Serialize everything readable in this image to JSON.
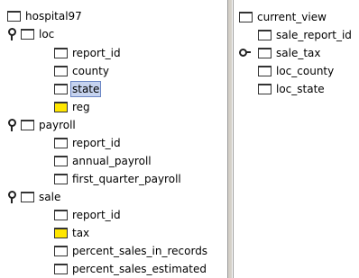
{
  "left_tree": {
    "root": {
      "label": "hospital97"
    },
    "nodes": [
      {
        "label": "loc",
        "children": [
          {
            "label": "report_id",
            "color": "white"
          },
          {
            "label": "county",
            "color": "white"
          },
          {
            "label": "state",
            "color": "white",
            "selected": true
          },
          {
            "label": "reg",
            "color": "yellow"
          }
        ]
      },
      {
        "label": "payroll",
        "children": [
          {
            "label": "report_id",
            "color": "white"
          },
          {
            "label": "annual_payroll",
            "color": "white"
          },
          {
            "label": "first_quarter_payroll",
            "color": "white"
          }
        ]
      },
      {
        "label": "sale",
        "children": [
          {
            "label": "report_id",
            "color": "white"
          },
          {
            "label": "tax",
            "color": "yellow"
          },
          {
            "label": "percent_sales_in_records",
            "color": "white"
          },
          {
            "label": "percent_sales_estimated",
            "color": "white"
          }
        ]
      }
    ]
  },
  "right_tree": {
    "root": {
      "label": "current_view"
    },
    "items": [
      {
        "label": "sale_report_id"
      },
      {
        "label": "sale_tax"
      },
      {
        "label": "loc_county"
      },
      {
        "label": "loc_state"
      }
    ]
  },
  "colors": {
    "folder_white": "#ffffff",
    "folder_yellow": "#ffe600",
    "selection": "#c6d3ef",
    "divider": "#d4d0c8"
  }
}
